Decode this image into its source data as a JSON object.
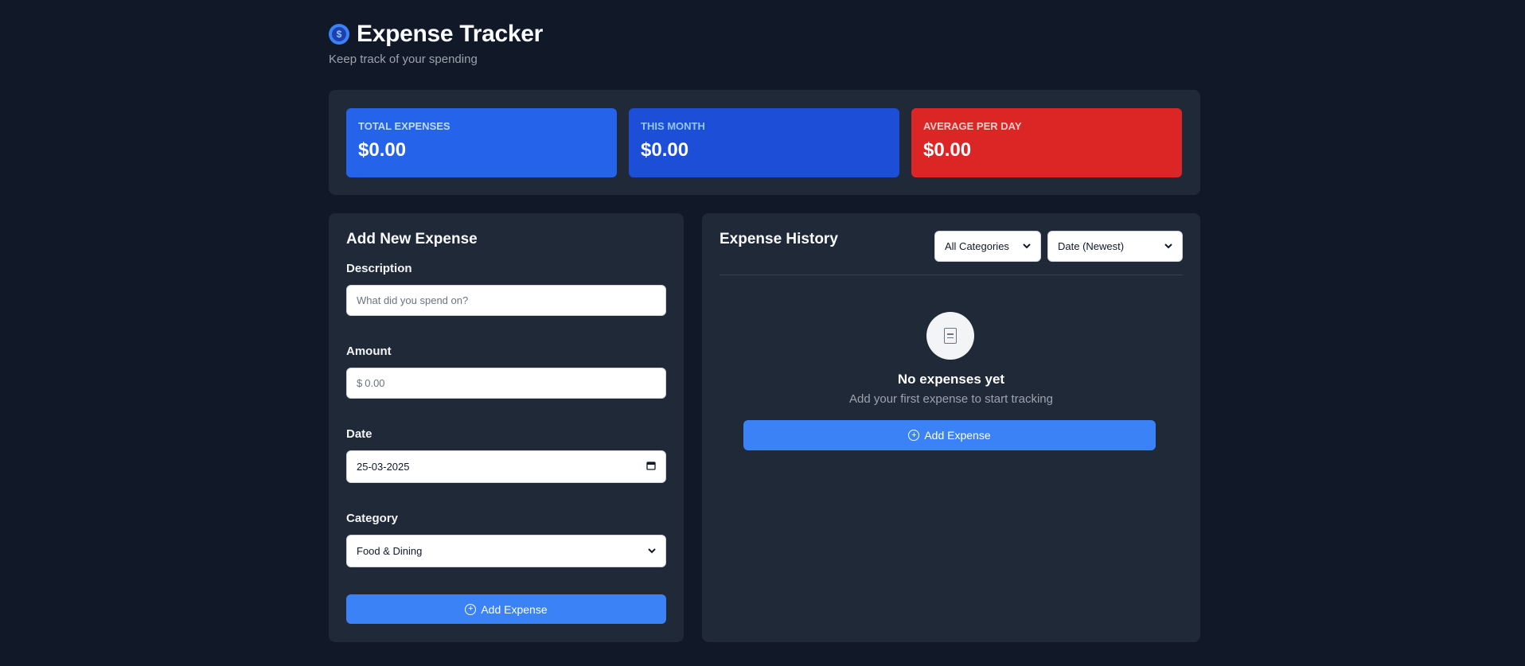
{
  "header": {
    "logo_glyph": "$",
    "title": "Expense Tracker",
    "subtitle": "Keep track of your spending"
  },
  "stats": {
    "total": {
      "label": "Total Expenses",
      "value": "$0.00",
      "color": "#2563eb"
    },
    "month": {
      "label": "This Month",
      "value": "$0.00",
      "color": "#1d4ed8"
    },
    "average": {
      "label": "Average Per Day",
      "value": "$0.00",
      "color": "#dc2626"
    }
  },
  "form": {
    "title": "Add New Expense",
    "description": {
      "label": "Description",
      "placeholder": "What did you spend on?",
      "value": ""
    },
    "amount": {
      "label": "Amount",
      "currency": "$",
      "placeholder": "0.00",
      "value": ""
    },
    "date": {
      "label": "Date",
      "value": "25-03-2025"
    },
    "category": {
      "label": "Category",
      "value": "Food & Dining"
    },
    "submit_label": "Add Expense"
  },
  "history": {
    "title": "Expense History",
    "category_filter": {
      "value": "All Categories"
    },
    "sort": {
      "value": "Date (Newest)"
    },
    "empty": {
      "title": "No expenses yet",
      "subtitle": "Add your first expense to start tracking",
      "button_label": "Add Expense"
    }
  },
  "colors": {
    "background": "#111827",
    "panel": "#1f2937",
    "accent": "#3b82f6",
    "danger": "#dc2626"
  }
}
